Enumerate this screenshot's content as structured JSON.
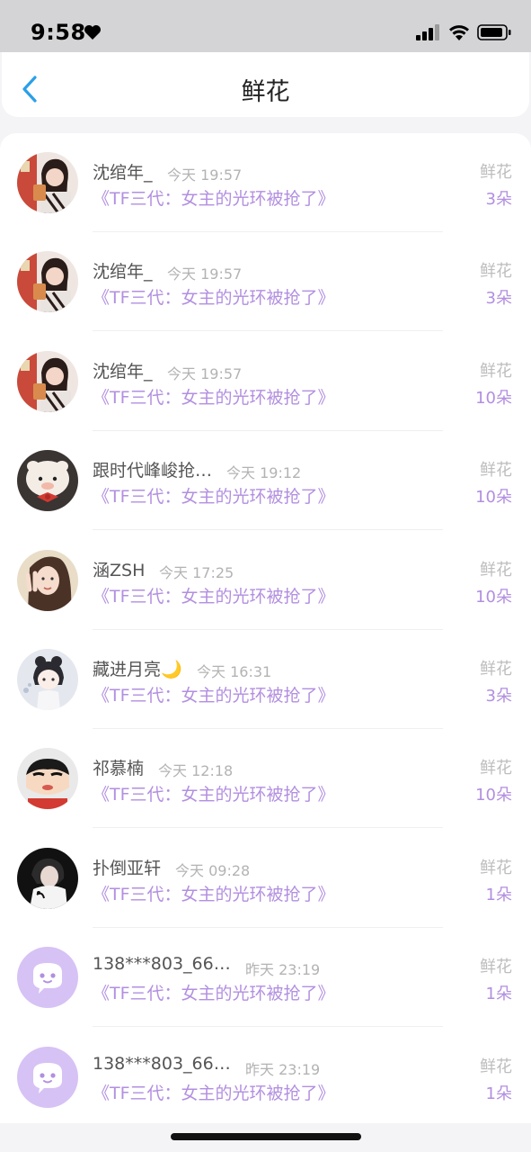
{
  "status_bar": {
    "time": "9:58"
  },
  "header": {
    "title": "鲜花"
  },
  "items": [
    {
      "name": "沈绾年_",
      "time": "今天 19:57",
      "book": "《TF三代：女主的光环被抢了》",
      "gift": "鲜花",
      "count": "3朵",
      "avatar": "photo-girl-red"
    },
    {
      "name": "沈绾年_",
      "time": "今天 19:57",
      "book": "《TF三代：女主的光环被抢了》",
      "gift": "鲜花",
      "count": "3朵",
      "avatar": "photo-girl-red"
    },
    {
      "name": "沈绾年_",
      "time": "今天 19:57",
      "book": "《TF三代：女主的光环被抢了》",
      "gift": "鲜花",
      "count": "10朵",
      "avatar": "photo-girl-red"
    },
    {
      "name": "跟时代峰峻抢…",
      "time": "今天 19:12",
      "book": "《TF三代：女主的光环被抢了》",
      "gift": "鲜花",
      "count": "10朵",
      "avatar": "plush-toy"
    },
    {
      "name": "涵ZSH",
      "time": "今天 17:25",
      "book": "《TF三代：女主的光环被抢了》",
      "gift": "鲜花",
      "count": "10朵",
      "avatar": "photo-girl-peace"
    },
    {
      "name": "藏进月亮🌙",
      "time": "今天 16:31",
      "book": "《TF三代：女主的光环被抢了》",
      "gift": "鲜花",
      "count": "3朵",
      "avatar": "anime-girl"
    },
    {
      "name": "祁慕楠",
      "time": "今天 12:18",
      "book": "《TF三代：女主的光环被抢了》",
      "gift": "鲜花",
      "count": "10朵",
      "avatar": "cartoon-boy"
    },
    {
      "name": "扑倒亚轩",
      "time": "今天 09:28",
      "book": "《TF三代：女主的光环被抢了》",
      "gift": "鲜花",
      "count": "1朵",
      "avatar": "photo-dark"
    },
    {
      "name": "138***803_66…",
      "time": "昨天 23:19",
      "book": "《TF三代：女主的光环被抢了》",
      "gift": "鲜花",
      "count": "1朵",
      "avatar": "default-chat-bubble"
    },
    {
      "name": "138***803_66…",
      "time": "昨天 23:19",
      "book": "《TF三代：女主的光环被抢了》",
      "gift": "鲜花",
      "count": "1朵",
      "avatar": "default-chat-bubble"
    }
  ],
  "colors": {
    "accent": "#b28fe0",
    "back_arrow": "#2a9fe8",
    "default_avatar": "#d6c2f5"
  }
}
